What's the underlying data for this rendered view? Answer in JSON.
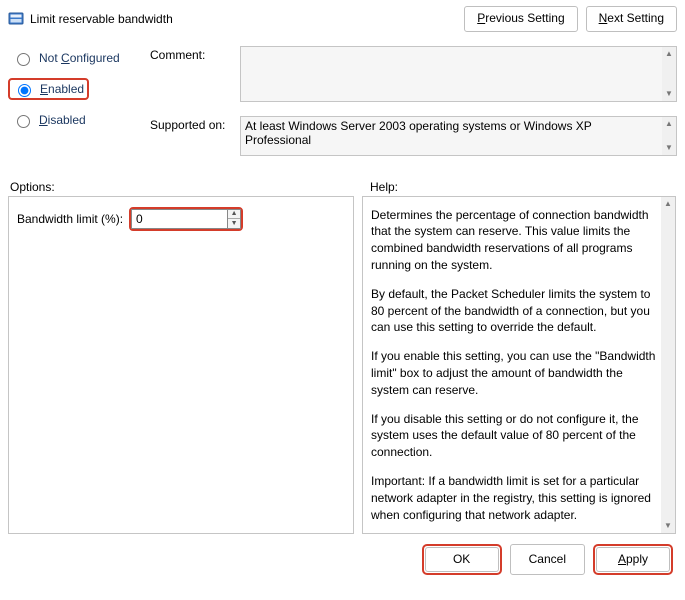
{
  "title": "Limit reservable bandwidth",
  "nav": {
    "prev": "Previous Setting",
    "next": "Next Setting"
  },
  "state": {
    "not_configured": "Not Configured",
    "enabled": "Enabled",
    "disabled": "Disabled",
    "selected": "enabled"
  },
  "comment_label": "Comment:",
  "comment_value": "",
  "supported_label": "Supported on:",
  "supported_value": "At least Windows Server 2003 operating systems or Windows XP Professional",
  "options_label": "Options:",
  "help_label": "Help:",
  "options": {
    "bandwidth_label": "Bandwidth limit (%):",
    "bandwidth_value": "0"
  },
  "help": {
    "p1": "Determines the percentage of connection bandwidth that the system can reserve. This value limits the combined bandwidth reservations of all programs running on the system.",
    "p2": "By default, the Packet Scheduler limits the system to 80 percent of the bandwidth of a connection, but you can use this setting to override the default.",
    "p3": "If you enable this setting, you can use the \"Bandwidth limit\" box to adjust the amount of bandwidth the system can reserve.",
    "p4": "If you disable this setting or do not configure it, the system uses the default value of 80 percent of the connection.",
    "p5": "Important: If a bandwidth limit is set for a particular network adapter in the registry, this setting is ignored when configuring that network adapter."
  },
  "footer": {
    "ok": "OK",
    "cancel": "Cancel",
    "apply": "Apply"
  }
}
